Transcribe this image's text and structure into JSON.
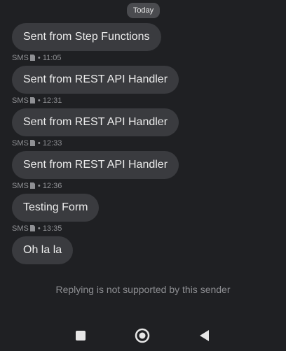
{
  "date_divider": "Today",
  "messages": [
    {
      "text": "Sent from Step Functions",
      "channel": "SMS",
      "time": "11:05"
    },
    {
      "text": "Sent from REST API Handler",
      "channel": "SMS",
      "time": "12:31"
    },
    {
      "text": "Sent from REST API Handler",
      "channel": "SMS",
      "time": "12:33"
    },
    {
      "text": "Sent from REST API Handler",
      "channel": "SMS",
      "time": "12:36"
    },
    {
      "text": "Testing Form",
      "channel": "SMS",
      "time": "13:35"
    },
    {
      "text": "Oh la la"
    }
  ],
  "footer_note": "Replying is not supported by this sender",
  "icons": {
    "sim": "sim-card-icon",
    "nav_recents": "square-recents-icon",
    "nav_home": "circle-home-icon",
    "nav_back": "triangle-back-icon"
  },
  "colors": {
    "background": "#1f2023",
    "bubble": "#3a3b3f",
    "meta_text": "#8f9094",
    "nav_icon": "#e6e6e6"
  }
}
